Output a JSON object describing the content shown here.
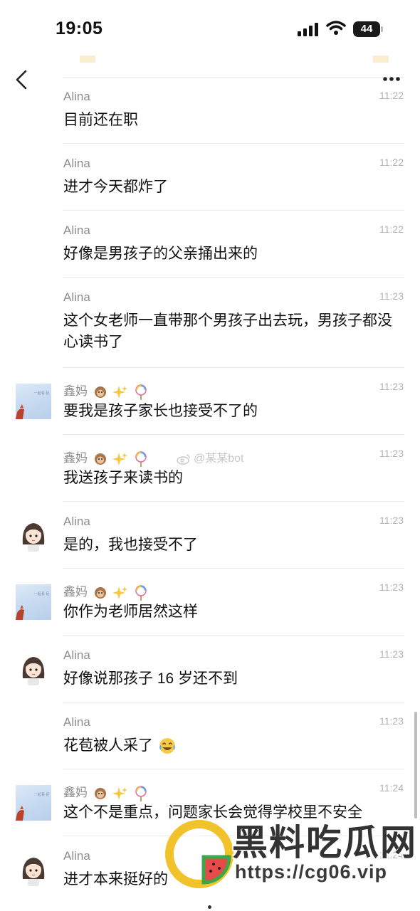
{
  "status_bar": {
    "time": "19:05",
    "battery_level": "44"
  },
  "watermarks": {
    "weibo": "@某某bot",
    "site_title": "黑料吃瓜网",
    "site_url": "https://cg06.vip"
  },
  "messages": [
    {
      "sender": "Alina",
      "time": "11:22",
      "text": "目前还在职",
      "avatar": "none"
    },
    {
      "sender": "Alina",
      "time": "11:22",
      "text": "进才今天都炸了",
      "avatar": "none"
    },
    {
      "sender": "Alina",
      "time": "11:22",
      "text": "好像是男孩子的父亲捅出来的",
      "avatar": "none"
    },
    {
      "sender": "Alina",
      "time": "11:23",
      "text": "这个女老师一直带那个男孩子出去玩，男孩子都没心读书了",
      "avatar": "none"
    },
    {
      "sender": "鑫妈",
      "sender_emojis": [
        "monkey",
        "sparkles",
        "lollipop"
      ],
      "time": "11:23",
      "text": "要我是孩子家长也接受不了的",
      "avatar": "sky-photo"
    },
    {
      "sender": "鑫妈",
      "sender_emojis": [
        "monkey",
        "sparkles",
        "lollipop"
      ],
      "time": "11:23",
      "text": "我送孩子来读书的",
      "avatar": "none"
    },
    {
      "sender": "Alina",
      "time": "11:23",
      "text": "是的，我也接受不了",
      "avatar": "girl-cartoon"
    },
    {
      "sender": "鑫妈",
      "sender_emojis": [
        "monkey",
        "sparkles",
        "lollipop"
      ],
      "time": "11:23",
      "text": "你作为老师居然这样",
      "avatar": "sky-photo"
    },
    {
      "sender": "Alina",
      "time": "11:23",
      "text": "好像说那孩子 16 岁还不到",
      "avatar": "girl-cartoon"
    },
    {
      "sender": "Alina",
      "time": "11:23",
      "text": "花苞被人采了",
      "trailing_emoji": "laughing-crying",
      "avatar": "none"
    },
    {
      "sender": "鑫妈",
      "sender_emojis": [
        "monkey",
        "sparkles",
        "lollipop"
      ],
      "time": "11:24",
      "text": "这个不是重点，问题家长会觉得学校里不安全",
      "avatar": "sky-photo"
    },
    {
      "sender": "Alina",
      "time": "11:24",
      "text": "进才本来挺好的",
      "avatar": "girl-cartoon"
    }
  ],
  "icons": {
    "back": "chevron-left-icon",
    "more": "more-horizontal-icon",
    "sender_emojis": [
      "monkey-icon",
      "sparkles-icon",
      "lollipop-icon"
    ]
  }
}
